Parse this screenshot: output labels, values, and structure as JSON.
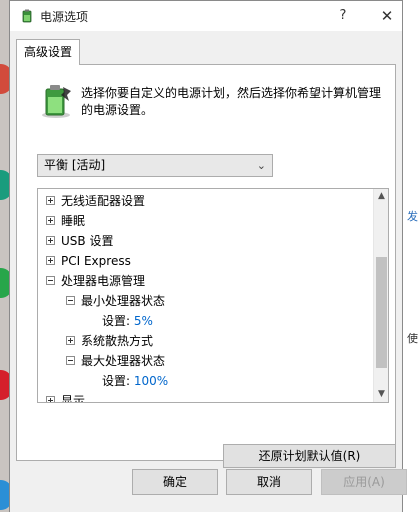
{
  "window": {
    "title": "电源选项",
    "help_glyph": "?",
    "close_glyph": "✕"
  },
  "tab": {
    "label": "高级设置"
  },
  "intro": {
    "text": "选择你要自定义的电源计划，然后选择你希望计算机管理的电源设置。"
  },
  "plan_select": {
    "value": "平衡 [活动]"
  },
  "tree": {
    "items": [
      {
        "label": "无线适配器设置"
      },
      {
        "label": "睡眠"
      },
      {
        "label": "USB 设置"
      },
      {
        "label": "PCI Express"
      },
      {
        "label": "处理器电源管理"
      },
      {
        "label": "最小处理器状态"
      },
      {
        "setting_label": "设置:",
        "setting_value": "5%"
      },
      {
        "label": "系统散热方式"
      },
      {
        "label": "最大处理器状态"
      },
      {
        "setting_label": "设置:",
        "setting_value": "100%"
      },
      {
        "label": "显示"
      }
    ]
  },
  "buttons": {
    "restore_defaults": "还原计划默认值(R)",
    "ok": "确定",
    "cancel": "取消",
    "apply": "应用(A)"
  },
  "background": {
    "right_fragment": "发",
    "right_fragment_2": "使"
  },
  "colors": {
    "setting_value": "#0066cc",
    "apply_disabled_text": "#9a9a9a"
  },
  "icons": [
    "power-options-icon",
    "battery-power-plan-icon",
    "help-icon",
    "close-icon",
    "chevron-down-icon",
    "scroll-up-icon",
    "scroll-down-icon"
  ]
}
